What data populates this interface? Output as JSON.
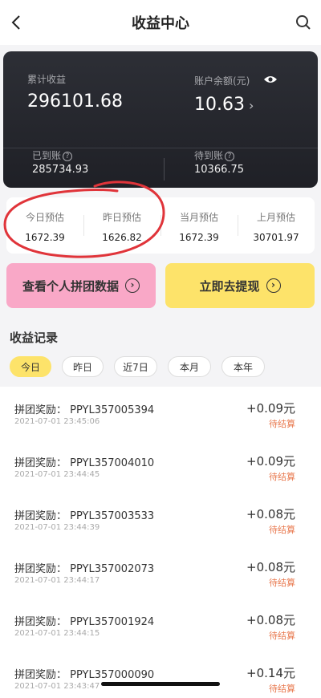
{
  "header": {
    "title": "收益中心"
  },
  "summary": {
    "total_label": "累计收益",
    "total_value": "296101.68",
    "balance_label": "账户余额(元)",
    "balance_value": "10.63",
    "arrived_label": "已到账",
    "arrived_value": "285734.93",
    "pending_label": "待到账",
    "pending_value": "10366.75"
  },
  "estimates": [
    {
      "label": "今日预估",
      "value": "1672.39"
    },
    {
      "label": "昨日预估",
      "value": "1626.82"
    },
    {
      "label": "当月预估",
      "value": "1672.39"
    },
    {
      "label": "上月预估",
      "value": "30701.97"
    }
  ],
  "actions": {
    "view_data": "查看个人拼团数据",
    "withdraw": "立即去提现"
  },
  "records_title": "收益记录",
  "filters": [
    "今日",
    "昨日",
    "近7日",
    "本月",
    "本年"
  ],
  "records": [
    {
      "title": "拼团奖励：  PPYL357005394",
      "time": "2021-07-01 23:45:06",
      "amount": "+0.09元",
      "status": "待结算"
    },
    {
      "title": "拼团奖励：  PPYL357004010",
      "time": "2021-07-01 23:44:45",
      "amount": "+0.09元",
      "status": "待结算"
    },
    {
      "title": "拼团奖励：  PPYL357003533",
      "time": "2021-07-01 23:44:39",
      "amount": "+0.08元",
      "status": "待结算"
    },
    {
      "title": "拼团奖励：  PPYL357002073",
      "time": "2021-07-01 23:44:17",
      "amount": "+0.08元",
      "status": "待结算"
    },
    {
      "title": "拼团奖励：  PPYL357001924",
      "time": "2021-07-01 23:44:15",
      "amount": "+0.08元",
      "status": "待结算"
    },
    {
      "title": "拼团奖励：  PPYL357000090",
      "time": "2021-07-01 23:43:47",
      "amount": "+0.14元",
      "status": "待结算"
    }
  ],
  "colors": {
    "accent_yellow": "#fde36a",
    "accent_pink": "#f9a8c7",
    "status_orange": "#e8784e",
    "annotation_red": "#e0343a"
  }
}
